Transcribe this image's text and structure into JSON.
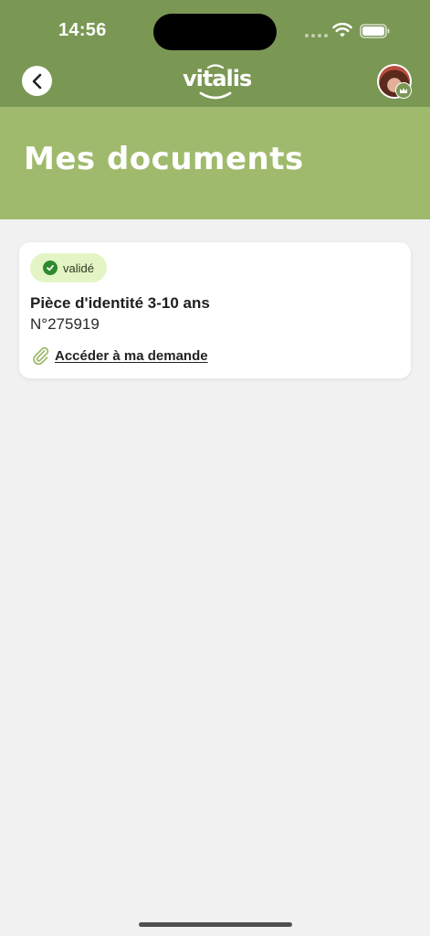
{
  "status_bar": {
    "time": "14:56",
    "icons": [
      "signal-icon",
      "wifi-icon",
      "battery-icon"
    ]
  },
  "nav": {
    "back_icon": "chevron-left-icon",
    "logo_text": "vitalis",
    "avatar": "profile-avatar"
  },
  "page": {
    "title": "Mes documents"
  },
  "documents": [
    {
      "status": "validé",
      "status_icon": "check-circle-icon",
      "title": "Pièce d'identité 3-10 ans",
      "number": "N°275919",
      "link_icon": "paperclip-icon",
      "link_label": "Accéder à ma demande"
    }
  ],
  "colors": {
    "top_bar": "#7a9754",
    "header_band": "#9fba6c",
    "badge_bg": "#e3f5c5",
    "badge_check": "#2e8a2e",
    "background": "#f1f1f1"
  }
}
